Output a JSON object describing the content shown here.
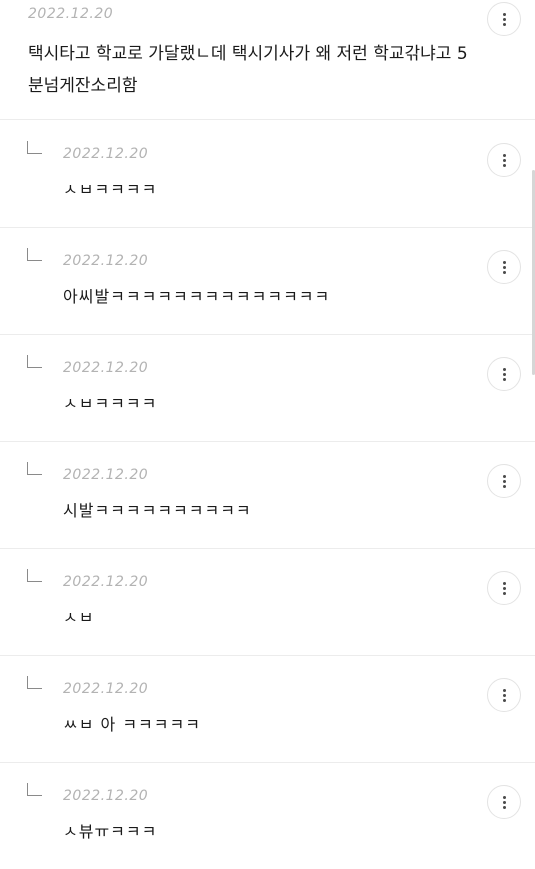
{
  "top_comment": {
    "date": "2022.12.20",
    "text": "택시타고 학교로 가달랬ㄴ데 택시기사가 왜 저런 학교갂냐고 5분넘게잔소리함"
  },
  "replies": [
    {
      "date": "2022.12.20",
      "text": "ㅅㅂㅋㅋㅋㅋ"
    },
    {
      "date": "2022.12.20",
      "text": "아씨발ㅋㅋㅋㅋㅋㅋㅋㅋㅋㅋㅋㅋㅋㅋ"
    },
    {
      "date": "2022.12.20",
      "text": "ㅅㅂㅋㅋㅋㅋ"
    },
    {
      "date": "2022.12.20",
      "text": "시발ㅋㅋㅋㅋㅋㅋㅋㅋㅋㅋ"
    },
    {
      "date": "2022.12.20",
      "text": "ㅅㅂ"
    },
    {
      "date": "2022.12.20",
      "text": "ㅆㅂ 아 ㅋㅋㅋㅋㅋ"
    },
    {
      "date": "2022.12.20",
      "text": "ㅅ뷰ㅠㅋㅋㅋ"
    }
  ]
}
